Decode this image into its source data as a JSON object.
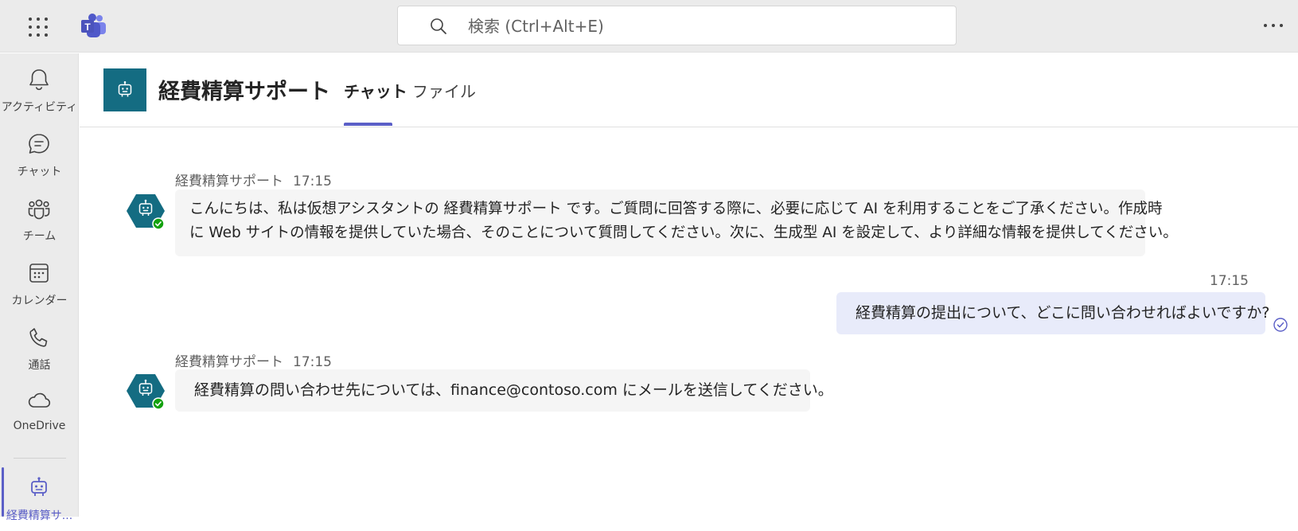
{
  "search": {
    "placeholder": "検索 (Ctrl+Alt+E)"
  },
  "rail": {
    "items": [
      {
        "label": "アクティビティ"
      },
      {
        "label": "チャット"
      },
      {
        "label": "チーム"
      },
      {
        "label": "カレンダー"
      },
      {
        "label": "通話"
      },
      {
        "label": "OneDrive"
      },
      {
        "label": "経費精算サ..."
      }
    ]
  },
  "header": {
    "title": "経費精算サポート",
    "tabs": [
      {
        "label": "チャット",
        "active": true
      },
      {
        "label": "ファイル",
        "active": false
      }
    ]
  },
  "messages": [
    {
      "sender": "経費精算サポート",
      "time": "17:15",
      "lines": [
        "こんにちは、私は仮想アシスタントの 経費精算サポート です。ご質問に回答する際に、必要に応じて AI を利用することをご了承ください。作成時",
        "に Web サイトの情報を提供していた場合、そのことについて質問してください。次に、生成型 AI を設定して、より詳細な情報を提供してください。"
      ]
    },
    {
      "time": "17:15",
      "text": "経費精算の提出について、どこに問い合わせればよいですか?"
    },
    {
      "sender": "経費精算サポート",
      "time": "17:15",
      "text": "経費精算の問い合わせ先については、finance@contoso.com にメールを送信してください。"
    }
  ],
  "colors": {
    "accent": "#5b5fc7",
    "bot_tile": "#146c82",
    "presence": "#13a10e",
    "my_bubble": "#e8ebfa"
  },
  "icons": [
    "waffle-icon",
    "teams-logo",
    "search-icon",
    "more-icon",
    "bell-icon",
    "chat-icon",
    "people-icon",
    "calendar-icon",
    "phone-icon",
    "cloud-icon",
    "bot-icon",
    "read-receipt-icon"
  ]
}
